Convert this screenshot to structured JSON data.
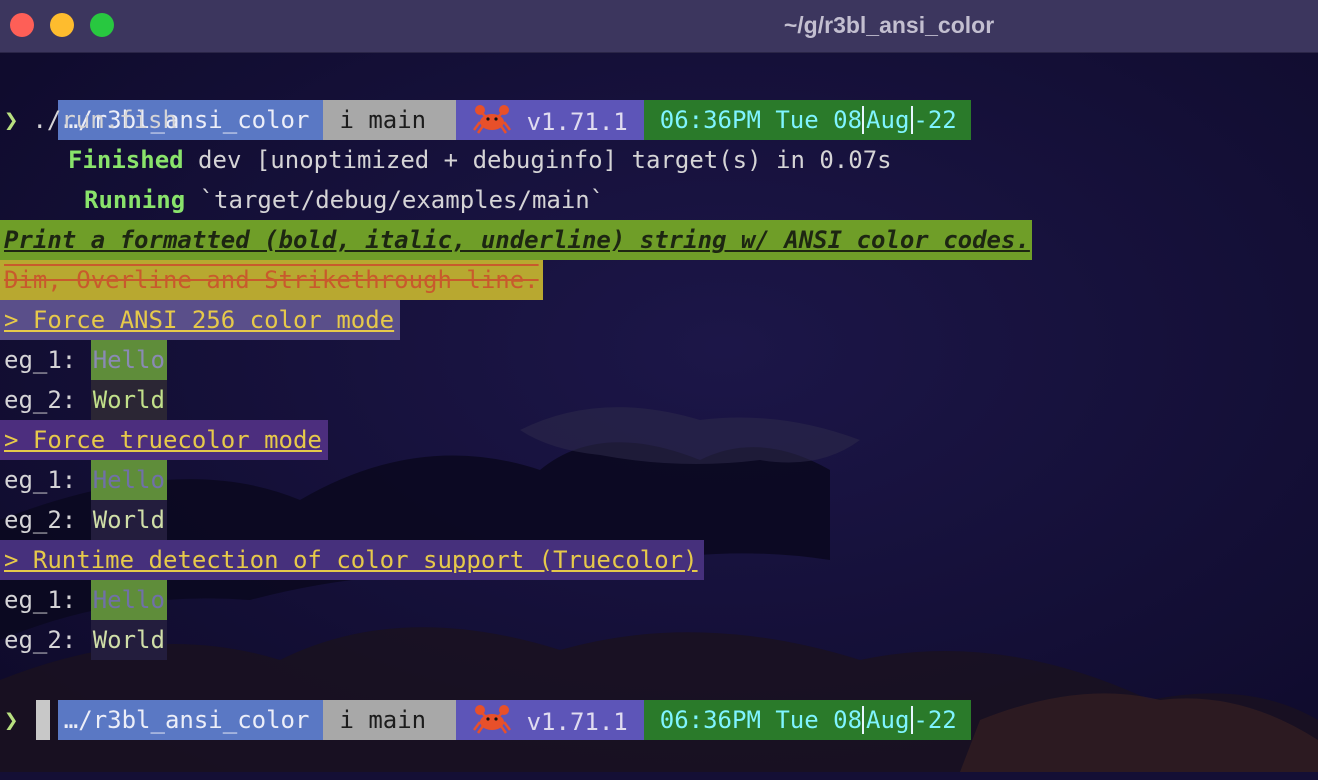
{
  "window": {
    "title": "~/g/r3bl_ansi_color"
  },
  "prompt_bar": {
    "dir": "…/r3bl_ansi_color",
    "git": "i main",
    "rust_icon": "crab-icon",
    "rust_version": "v1.71.1",
    "time": "06:36PM Tue 08",
    "month": "Aug",
    "year": "-22"
  },
  "prompt_symbol": "❯",
  "command": "./run.fish",
  "cargo": {
    "finished_word": "Finished",
    "finished_rest": " dev [unoptimized + debuginfo] target(s) in 0.07s",
    "running_word": "Running",
    "running_rest": " `target/debug/examples/main`"
  },
  "formatted_line": "Print a formatted (bold, italic, underline) string w/ ANSI color codes.",
  "dim_line": "Dim, Overline and Strikethrough line.",
  "sections": [
    {
      "header": "> Force ANSI 256 color mode",
      "eg1_label": "eg_1: ",
      "eg1_value": "Hello",
      "eg2_label": "eg_2: ",
      "eg2_value": "World"
    },
    {
      "header": "> Force truecolor mode",
      "eg1_label": "eg_1: ",
      "eg1_value": "Hello",
      "eg2_label": "eg_2: ",
      "eg2_value": "World"
    },
    {
      "header": "> Runtime detection of color support (Truecolor)",
      "eg1_label": "eg_1: ",
      "eg1_value": "Hello",
      "eg2_label": "eg_2: ",
      "eg2_value": "World"
    }
  ],
  "colors": {
    "terminal_bg": "#140f35",
    "dir_segment": "#5a78c4",
    "git_segment": "#a8a8a8",
    "rust_segment": "#5d55b8",
    "date_segment": "#2a7a2a",
    "cargo_green": "#89e36b",
    "header_yellow": "#e6c94a"
  }
}
